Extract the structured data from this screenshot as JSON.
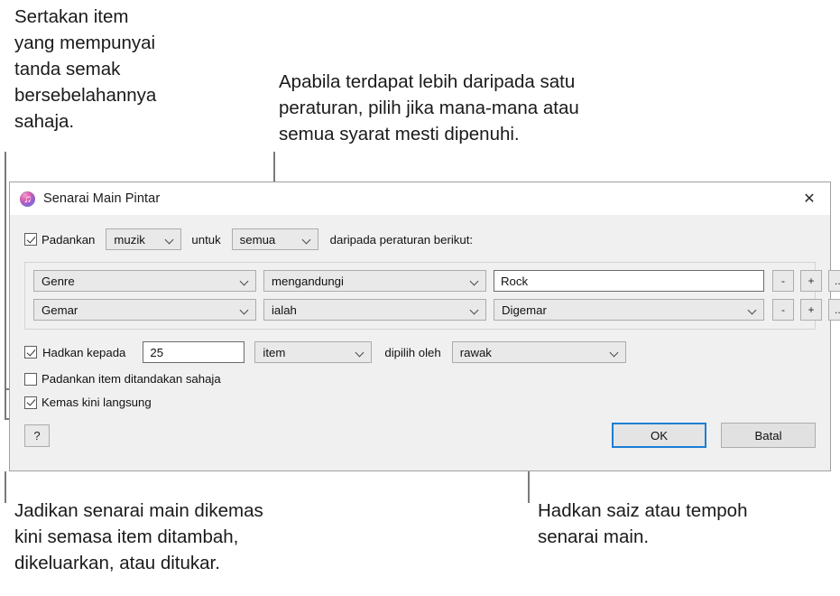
{
  "annotations": {
    "top_left": "Sertakan item\nyang mempunyai\ntanda semak\nbersebelahannya\nsahaja.",
    "top_right": "Apabila terdapat lebih daripada satu\nperaturan, pilih jika mana-mana atau\nsemua syarat mesti dipenuhi.",
    "bottom_left": "Jadikan senarai main dikemas\nkini semasa item ditambah,\ndikeluarkan, atau ditukar.",
    "bottom_right": "Hadkan saiz atau tempoh\nsenarai main."
  },
  "dialog": {
    "title": "Senarai Main Pintar",
    "app_icon": "itunes-icon",
    "close_icon": "✕",
    "match": {
      "checkbox_checked": true,
      "label": "Padankan",
      "kind_value": "muzik",
      "between_label": "untuk",
      "scope_value": "semua",
      "trailing_label": "daripada peraturan berikut:"
    },
    "rules": [
      {
        "field": "Genre",
        "operator": "mengandungi",
        "value": "Rock",
        "value_type": "textbox",
        "remove_label": "-",
        "add_label": "+",
        "more_label": "..."
      },
      {
        "field": "Gemar",
        "operator": "ialah",
        "value": "Digemar",
        "value_type": "combo",
        "remove_label": "-",
        "add_label": "+",
        "more_label": "..."
      }
    ],
    "limit": {
      "checkbox_checked": true,
      "label": "Hadkan kepada",
      "amount": "25",
      "unit_value": "item",
      "chosen_by_label": "dipilih oleh",
      "selection_value": "rawak"
    },
    "only_checked": {
      "checkbox_checked": false,
      "label": "Padankan item ditandakan sahaja"
    },
    "live_update": {
      "checkbox_checked": true,
      "label": "Kemas kini langsung"
    },
    "buttons": {
      "help_label": "?",
      "ok_label": "OK",
      "cancel_label": "Batal"
    }
  },
  "colors": {
    "accent_focus": "#1a7fd4",
    "dialog_bg": "#f0f0f0",
    "control_bg": "#e9e9e9",
    "leader_line": "#7a7a7a"
  }
}
